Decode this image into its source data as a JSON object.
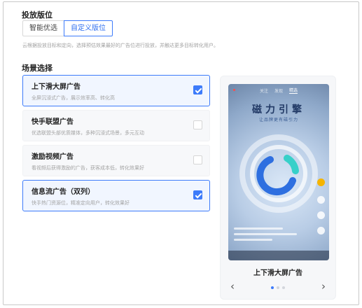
{
  "placement": {
    "title": "投放版位",
    "tabs": [
      {
        "label": "智能优选",
        "active": false
      },
      {
        "label": "自定义版位",
        "active": true
      }
    ],
    "hint": "云根据投放目标和定向，选择预估效果最好的广告位进行投放，并触达更多目标转化用户。"
  },
  "scenes": {
    "title": "场景选择",
    "options": [
      {
        "title": "上下滑大屏广告",
        "desc": "全屏沉浸式广告，展示效率高、转化高",
        "checked": true
      },
      {
        "title": "快手联盟广告",
        "desc": "优选联盟头部优质媒体，多种沉浸式场景，多元互动",
        "checked": false
      },
      {
        "title": "激励视频广告",
        "desc": "看视频后获得激励的广告，获客成本低，转化效果好",
        "checked": false
      },
      {
        "title": "信息流广告（双列）",
        "desc": "快手热门资源位，精准定向用户，转化效果好",
        "checked": true
      }
    ]
  },
  "preview": {
    "phone_tabs": [
      "关注",
      "发现",
      "精选"
    ],
    "hero_text": "磁力引擎",
    "hero_sub": "让品牌更有磁引力",
    "label": "上下滑大屏广告",
    "prev": "‹",
    "next": "›",
    "page_count": 3,
    "current_page": 1
  },
  "colors": {
    "accent": "#3d7bfa",
    "selected_bg": "#f1f6ff",
    "option_bg": "#f7f8fa"
  }
}
